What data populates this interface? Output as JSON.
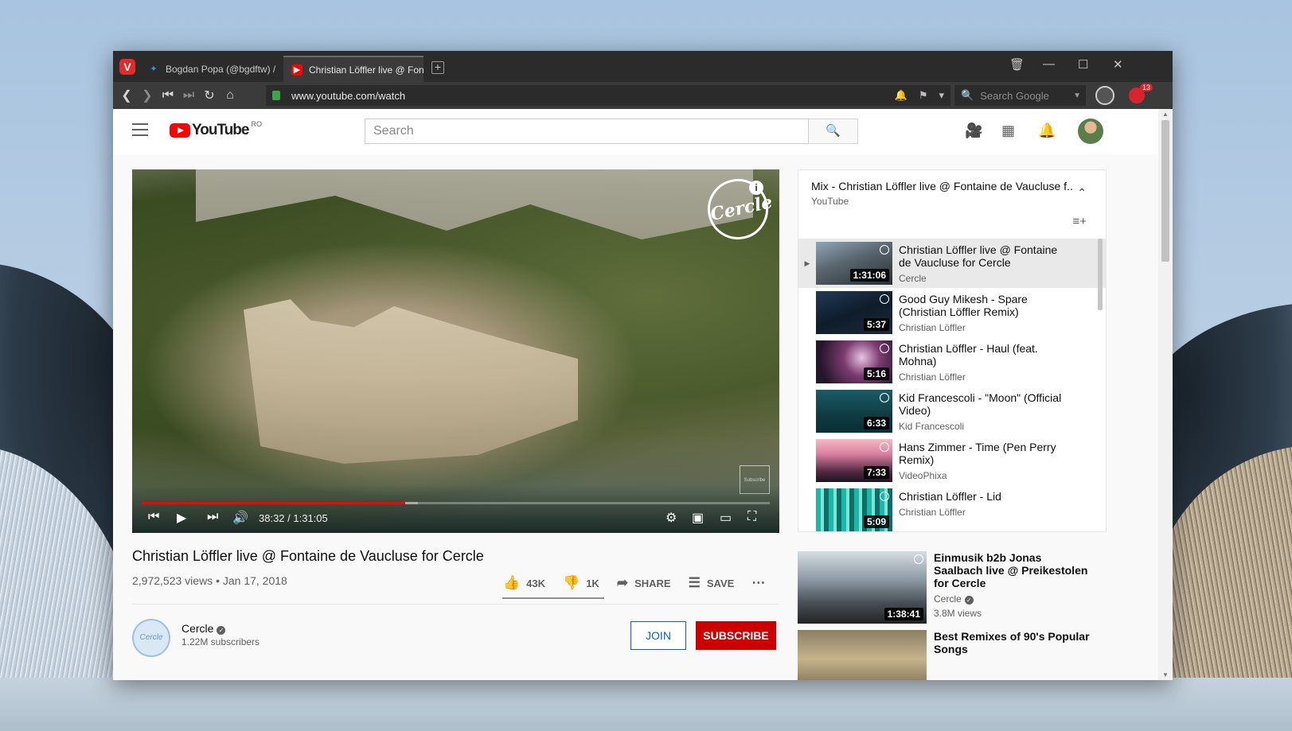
{
  "browser": {
    "tabs": [
      {
        "label": "Bogdan Popa (@bgdftw) / ",
        "icon": "twitter-icon"
      },
      {
        "label": "Christian Löffler live @ Fon",
        "icon": "youtube-icon",
        "active": true
      }
    ],
    "url": "www.youtube.com/watch",
    "search_placeholder": "Search Google",
    "extension_badge": "13"
  },
  "youtube": {
    "region": "RO",
    "logo_text": "YouTube",
    "search_placeholder": "Search",
    "player": {
      "watermark": "Cercle",
      "subscribe_watermark": "Subscribe",
      "time": "38:32 / 1:31:05",
      "progress": 0.42,
      "buffered": 0.44
    },
    "video": {
      "title": "Christian Löffler live @ Fontaine de Vaucluse for Cercle",
      "meta": "2,972,523 views • Jan 17, 2018",
      "likes": "43K",
      "dislikes": "1K",
      "share": "SHARE",
      "save": "SAVE"
    },
    "channel": {
      "name": "Cercle",
      "subscribers": "1.22M subscribers",
      "avatar_text": "Cercle",
      "join": "JOIN",
      "subscribe": "SUBSCRIBE"
    },
    "playlist": {
      "title": "Mix - Christian Löffler live @ Fontaine de Vaucluse f...",
      "owner": "YouTube",
      "items": [
        {
          "title": "Christian Löffler live @ Fontaine de Vaucluse for Cercle",
          "channel": "Cercle",
          "duration": "1:31:06",
          "active": true,
          "thumb": "t-a"
        },
        {
          "title": "Good Guy Mikesh - Spare (Christian Löffler Remix)",
          "channel": "Christian Löffler",
          "duration": "5:37",
          "thumb": "t-b"
        },
        {
          "title": "Christian Löffler - Haul (feat. Mohna)",
          "channel": "Christian Löffler",
          "duration": "5:16",
          "thumb": "t-c"
        },
        {
          "title": "Kid Francescoli - \"Moon\" (Official Video)",
          "channel": "Kid Francescoli",
          "duration": "6:33",
          "thumb": "t-d"
        },
        {
          "title": "Hans Zimmer - Time (Pen Perry Remix)",
          "channel": "VideoPhixa",
          "duration": "7:33",
          "thumb": "t-e"
        },
        {
          "title": "Christian Löffler - Lid",
          "channel": "Christian Löffler",
          "duration": "5:09",
          "thumb": "t-f"
        }
      ]
    },
    "recommendations": [
      {
        "title": "Einmusik b2b Jonas Saalbach live @ Preikestolen for Cercle",
        "channel": "Cercle",
        "views": "3.8M views",
        "duration": "1:38:41",
        "thumb": "t-g"
      },
      {
        "title": "Best Remixes of 90's Popular Songs",
        "channel": "",
        "views": "",
        "duration": "",
        "thumb": "t-h"
      }
    ]
  }
}
